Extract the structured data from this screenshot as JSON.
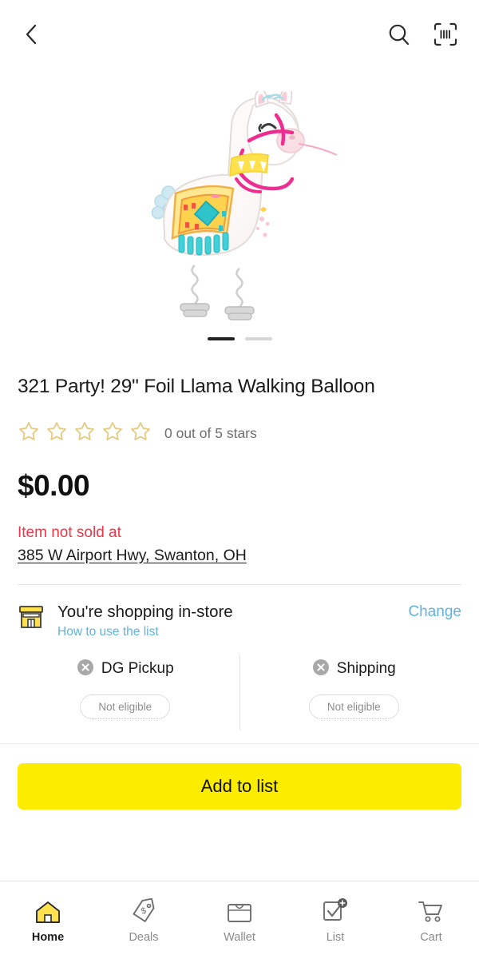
{
  "header": {
    "back_icon": "chevron-left-icon",
    "search_icon": "search-icon",
    "scan_icon": "barcode-scan-icon"
  },
  "gallery": {
    "image_alt": "321 Party! 29\" Foil Llama Walking Balloon",
    "slide_count": 2,
    "active_slide": 1
  },
  "product": {
    "title": "321 Party! 29\" Foil Llama Walking Balloon",
    "rating_value": 0,
    "rating_max": 5,
    "rating_text": "0 out of 5 stars",
    "price": "$0.00",
    "availability_message": "Item not sold at",
    "store_address": "385 W Airport Hwy, Swanton, OH"
  },
  "shopping_mode": {
    "icon": "storefront-icon",
    "title": "You're shopping in-store",
    "help_link": "How to use the list",
    "change_link": "Change"
  },
  "fulfillment": [
    {
      "icon": "x-circle-icon",
      "label": "DG Pickup",
      "status": "Not eligible"
    },
    {
      "icon": "x-circle-icon",
      "label": "Shipping",
      "status": "Not eligible"
    }
  ],
  "cta": {
    "label": "Add to list"
  },
  "bottom_nav": [
    {
      "label": "Home",
      "icon": "home-icon",
      "active": true
    },
    {
      "label": "Deals",
      "icon": "tag-icon",
      "active": false
    },
    {
      "label": "Wallet",
      "icon": "wallet-icon",
      "active": false
    },
    {
      "label": "List",
      "icon": "list-check-icon",
      "active": false
    },
    {
      "label": "Cart",
      "icon": "shopping-cart-icon",
      "active": false
    }
  ],
  "colors": {
    "accent_yellow": "#fcec00",
    "link_blue": "#5fb3dd",
    "alert_red": "#e8394a",
    "star_gold": "#e4c97d",
    "muted_gray": "#8b8b8b"
  }
}
